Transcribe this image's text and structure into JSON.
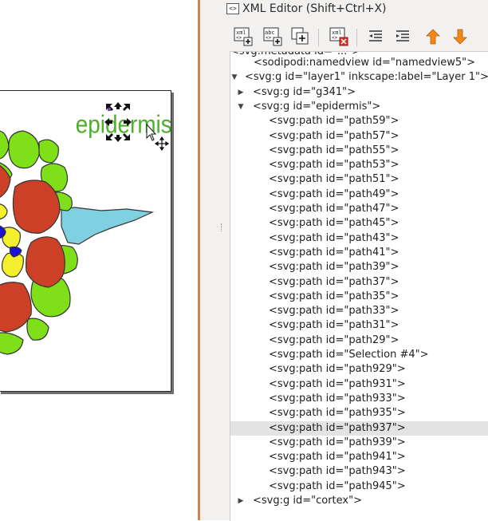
{
  "canvas": {
    "label_text": "epidermis",
    "colors": {
      "epidermis_green": "#7fe01a",
      "cortex_red": "#cb4027",
      "stele_yellow": "#f5f02d",
      "phloem_blue": "#1a10d6",
      "root_hair_cyan": "#7fd0e0",
      "label_green": "#4caf2a"
    },
    "selection_handles": "scale-arrows",
    "cursor": "pointer-with-move-icon"
  },
  "panel": {
    "title": "XML Editor (Shift+Ctrl+X)",
    "icon": "xml-editor-icon"
  },
  "toolbar": {
    "buttons": [
      {
        "icon": "new-element-node-icon",
        "glyph": "xml"
      },
      {
        "icon": "new-text-node-icon",
        "glyph": "abc"
      },
      {
        "icon": "duplicate-node-icon",
        "glyph": ""
      },
      {
        "icon": "delete-node-icon",
        "glyph": "xml"
      },
      {
        "icon": "unindent-node-icon",
        "glyph": ""
      },
      {
        "icon": "indent-node-icon",
        "glyph": ""
      },
      {
        "icon": "raise-node-icon",
        "glyph": "↑"
      },
      {
        "icon": "lower-node-icon",
        "glyph": "↓"
      }
    ]
  },
  "tree": {
    "partial_top": "<svg:metadata id=\"...\">",
    "nodes": [
      {
        "text": "<sodipodi:namedview id=\"namedview5\">",
        "level": 0,
        "expander": ""
      },
      {
        "text": "<svg:g id=\"layer1\" inkscape:label=\"Layer 1\">",
        "level": 0,
        "expander": "open"
      },
      {
        "text": "<svg:g id=\"g341\">",
        "level": 1,
        "expander": "closed"
      },
      {
        "text": "<svg:g id=\"epidermis\">",
        "level": 1,
        "expander": "open"
      },
      {
        "text": "<svg:path id=\"path59\">",
        "level": 2,
        "expander": ""
      },
      {
        "text": "<svg:path id=\"path57\">",
        "level": 2,
        "expander": ""
      },
      {
        "text": "<svg:path id=\"path55\">",
        "level": 2,
        "expander": ""
      },
      {
        "text": "<svg:path id=\"path53\">",
        "level": 2,
        "expander": ""
      },
      {
        "text": "<svg:path id=\"path51\">",
        "level": 2,
        "expander": ""
      },
      {
        "text": "<svg:path id=\"path49\">",
        "level": 2,
        "expander": ""
      },
      {
        "text": "<svg:path id=\"path47\">",
        "level": 2,
        "expander": ""
      },
      {
        "text": "<svg:path id=\"path45\">",
        "level": 2,
        "expander": ""
      },
      {
        "text": "<svg:path id=\"path43\">",
        "level": 2,
        "expander": ""
      },
      {
        "text": "<svg:path id=\"path41\">",
        "level": 2,
        "expander": ""
      },
      {
        "text": "<svg:path id=\"path39\">",
        "level": 2,
        "expander": ""
      },
      {
        "text": "<svg:path id=\"path37\">",
        "level": 2,
        "expander": ""
      },
      {
        "text": "<svg:path id=\"path35\">",
        "level": 2,
        "expander": ""
      },
      {
        "text": "<svg:path id=\"path33\">",
        "level": 2,
        "expander": ""
      },
      {
        "text": "<svg:path id=\"path31\">",
        "level": 2,
        "expander": ""
      },
      {
        "text": "<svg:path id=\"path29\">",
        "level": 2,
        "expander": ""
      },
      {
        "text": "<svg:path id=\"Selection #4\">",
        "level": 2,
        "expander": ""
      },
      {
        "text": "<svg:path id=\"path929\">",
        "level": 2,
        "expander": ""
      },
      {
        "text": "<svg:path id=\"path931\">",
        "level": 2,
        "expander": ""
      },
      {
        "text": "<svg:path id=\"path933\">",
        "level": 2,
        "expander": ""
      },
      {
        "text": "<svg:path id=\"path935\">",
        "level": 2,
        "expander": ""
      },
      {
        "text": "<svg:path id=\"path937\">",
        "level": 2,
        "expander": "",
        "selected": true
      },
      {
        "text": "<svg:path id=\"path939\">",
        "level": 2,
        "expander": ""
      },
      {
        "text": "<svg:path id=\"path941\">",
        "level": 2,
        "expander": ""
      },
      {
        "text": "<svg:path id=\"path943\">",
        "level": 2,
        "expander": ""
      },
      {
        "text": "<svg:path id=\"path945\">",
        "level": 2,
        "expander": ""
      },
      {
        "text": "<svg:g id=\"cortex\">",
        "level": 1,
        "expander": "closed"
      }
    ]
  }
}
